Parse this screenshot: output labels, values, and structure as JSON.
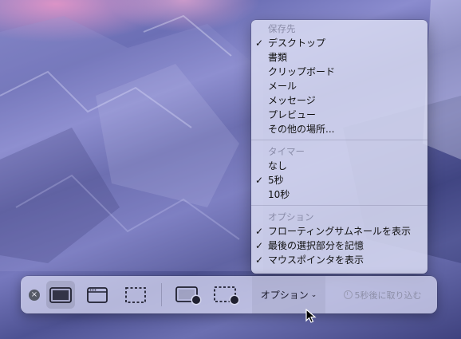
{
  "menu": {
    "save_header": "保存先",
    "save_items": [
      {
        "label": "デスクトップ",
        "checked": true
      },
      {
        "label": "書類",
        "checked": false
      },
      {
        "label": "クリップボード",
        "checked": false
      },
      {
        "label": "メール",
        "checked": false
      },
      {
        "label": "メッセージ",
        "checked": false
      },
      {
        "label": "プレビュー",
        "checked": false
      },
      {
        "label": "その他の場所...",
        "checked": false
      }
    ],
    "timer_header": "タイマー",
    "timer_items": [
      {
        "label": "なし",
        "checked": false
      },
      {
        "label": "5秒",
        "checked": true
      },
      {
        "label": "10秒",
        "checked": false
      }
    ],
    "options_header": "オプション",
    "options_items": [
      {
        "label": "フローティングサムネールを表示",
        "checked": true
      },
      {
        "label": "最後の選択部分を記憶",
        "checked": true
      },
      {
        "label": "マウスポインタを表示",
        "checked": true
      }
    ],
    "check_glyph": "✓"
  },
  "toolbar": {
    "close_glyph": "×",
    "options_label": "オプション",
    "options_chevron": "⌄",
    "capture_label": "5秒後に取り込む",
    "selected_tool": "capture-entire-screen"
  }
}
